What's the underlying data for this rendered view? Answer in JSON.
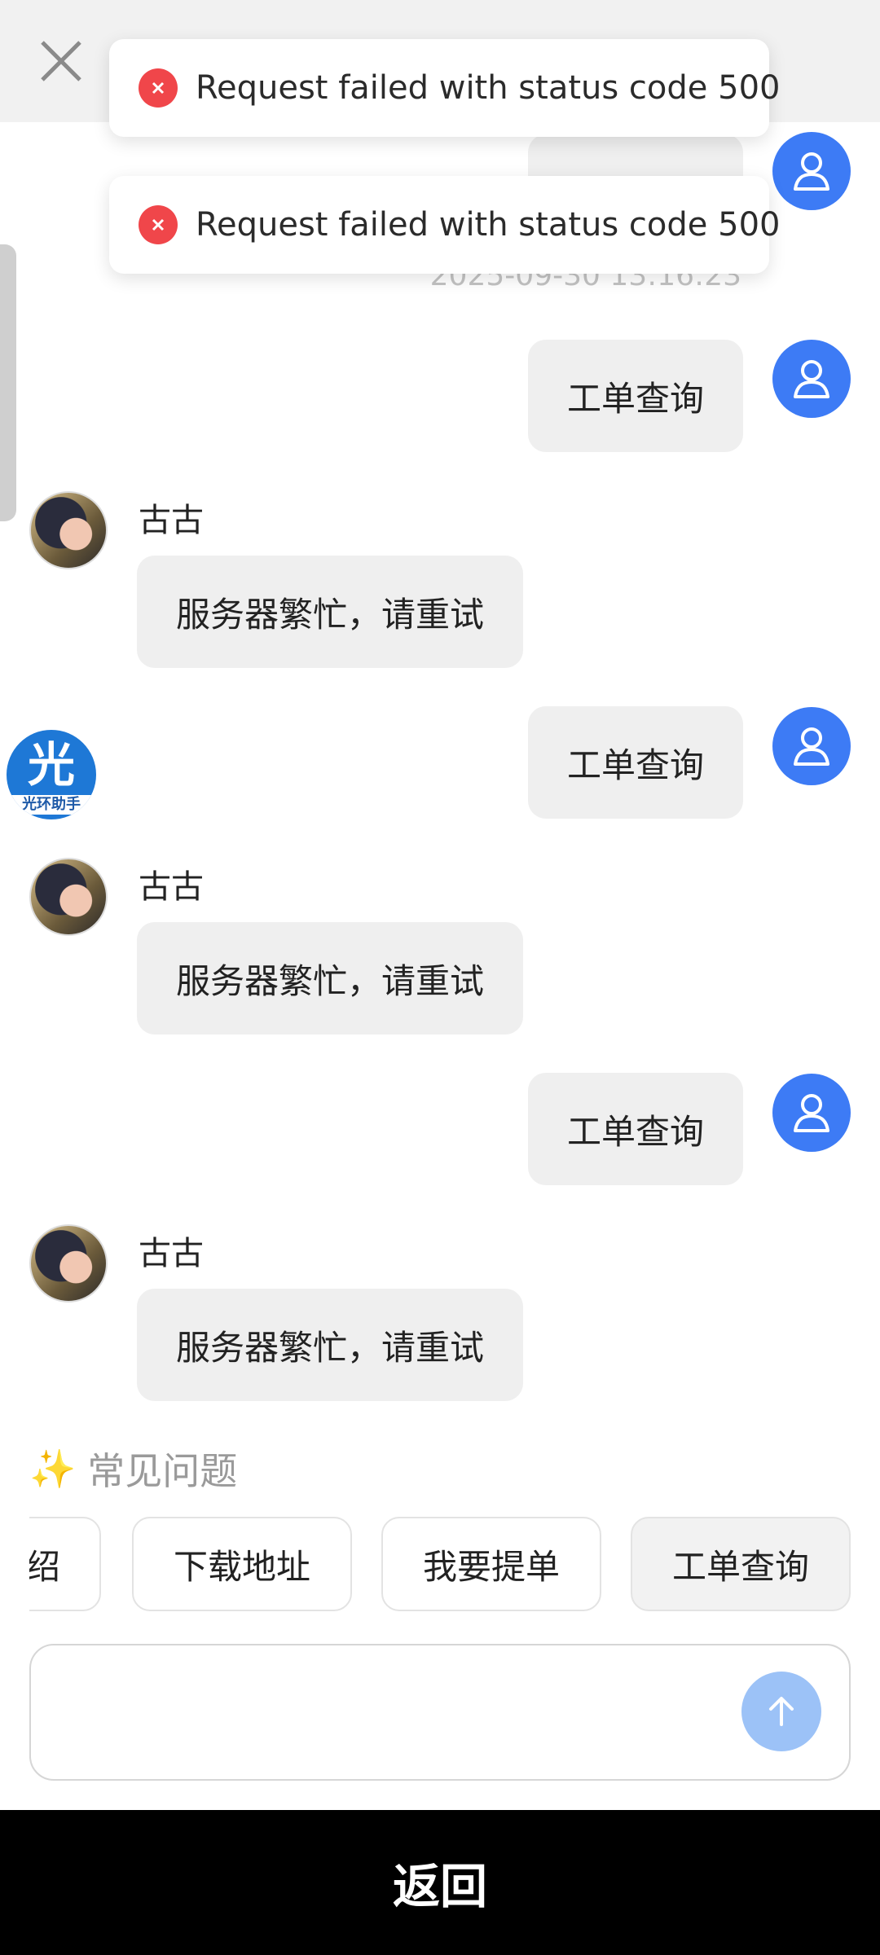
{
  "header": {
    "close_icon": "close-icon"
  },
  "toasts": [
    {
      "message": "Request failed with status code 500",
      "icon": "error-icon",
      "color": "#f0464a"
    },
    {
      "message": "Request failed with status code 500",
      "icon": "error-icon",
      "color": "#f0464a"
    }
  ],
  "chat": {
    "partial_user_message": "工单查询",
    "timestamp": "2025-09-30 13:16:23",
    "bot_name": "古古",
    "messages": [
      {
        "role": "user",
        "text": "工单查询"
      },
      {
        "role": "bot",
        "name": "古古",
        "text": "服务器繁忙，请重试"
      },
      {
        "role": "user",
        "text": "工单查询"
      },
      {
        "role": "bot",
        "name": "古古",
        "text": "服务器繁忙，请重试"
      },
      {
        "role": "user",
        "text": "工单查询"
      },
      {
        "role": "bot",
        "name": "古古",
        "text": "服务器繁忙，请重试"
      }
    ]
  },
  "floating_assistant": {
    "big_char": "光",
    "label": "光环助手"
  },
  "faq": {
    "icon": "sparkles-icon",
    "title": "常见问题",
    "chips": [
      "绍",
      "下载地址",
      "我要提单",
      "工单查询"
    ]
  },
  "input": {
    "placeholder": "",
    "send_icon": "arrow-up-icon"
  },
  "bottom_bar": {
    "label": "返回"
  },
  "colors": {
    "accent": "#3d7bf5",
    "send_disabled": "#9cc2f7",
    "error": "#f0464a"
  }
}
